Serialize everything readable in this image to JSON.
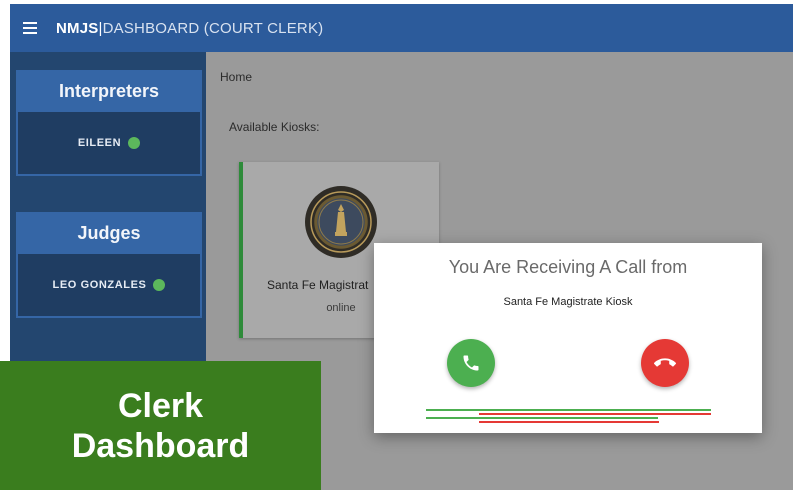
{
  "header": {
    "app_name": "NMJS",
    "separator": "|",
    "section": "DASHBOARD (COURT CLERK)"
  },
  "sidebar": {
    "interpreters": {
      "title": "Interpreters",
      "items": [
        {
          "name": "EILEEN",
          "status": "online"
        }
      ]
    },
    "judges": {
      "title": "Judges",
      "items": [
        {
          "name": "LEO GONZALES",
          "status": "online"
        }
      ]
    }
  },
  "main": {
    "breadcrumb": "Home",
    "kiosks_label": "Available Kiosks:",
    "kiosks": [
      {
        "name": "Santa Fe Magistrat",
        "status": "online"
      }
    ]
  },
  "call_dialog": {
    "title": "You Are Receiving A Call from",
    "caller": "Santa Fe Magistrate Kiosk"
  },
  "overlay": {
    "line1": "Clerk",
    "line2": "Dashboard"
  },
  "colors": {
    "app_bar": "#2c5b9b",
    "accept": "#4caf50",
    "reject": "#e53935",
    "online": "#5cb85c",
    "overlay": "#3a7d1e"
  }
}
